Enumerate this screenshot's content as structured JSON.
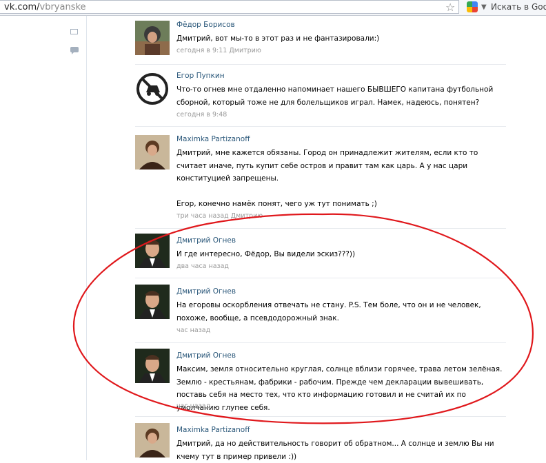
{
  "browser": {
    "url_host": "vk.com/",
    "url_path": "vbryanske",
    "search_placeholder": "Искать в Goog"
  },
  "comments": [
    {
      "author": "Фёдор Борисов",
      "text": [
        "Дмитрий, вот мы-то в этот раз и не фантазировали:)"
      ],
      "time": "сегодня в 9:11 Дмитрию"
    },
    {
      "author": "Егор Пупкин",
      "text": [
        "Что-то огнев мне отдаленно напоминает нашего БЫВШЕГО капитана футбольной сборной, который тоже не для болельщиков играл. Намек, надеюсь, понятен?"
      ],
      "time": "сегодня в 9:48"
    },
    {
      "author": "Maximka Partizanoff",
      "text": [
        "Дмитрий, мне кажется обязаны. Город он принадлежит жителям, если кто то считает иначе, путь купит себе остров и правит там как царь. А у нас цари конституцией запрещены.",
        "",
        "Егор, конечно намёк понят, чего уж тут понимать ;)"
      ],
      "time": "три часа назад Дмитрию"
    },
    {
      "author": "Дмитрий Огнев",
      "text": [
        "И где интересно, Фёдор, Вы видели эскиз???))"
      ],
      "time": "два часа назад"
    },
    {
      "author": "Дмитрий Огнев",
      "text": [
        "На егоровы оскорбления отвечать не стану. P.S. Тем боле, что он и не человек, похоже, вообще, а псевдодорожный знак."
      ],
      "time": "час назад"
    },
    {
      "author": "Дмитрий Огнев",
      "text": [
        "Максим, земля относительно круглая, солнце вблизи горячее, трава летом зелёная. Землю - крестьянам, фабрики - рабочим. Прежде чем декларации вывешивать, поставь себя на место тех, что кто информацию готовил и не считай их по умолчанию глупее себя."
      ],
      "time": "час назад"
    },
    {
      "author": "Maximka Partizanoff",
      "text": [
        "Дмитрий, да но действительность говорит об обратном... А солнце и землю Вы ни кчему тут в пример привели :))"
      ],
      "time": ""
    }
  ],
  "colors": {
    "author_link": "#2b587a",
    "timestamp": "#999999",
    "annotation_oval": "#e0181c"
  }
}
